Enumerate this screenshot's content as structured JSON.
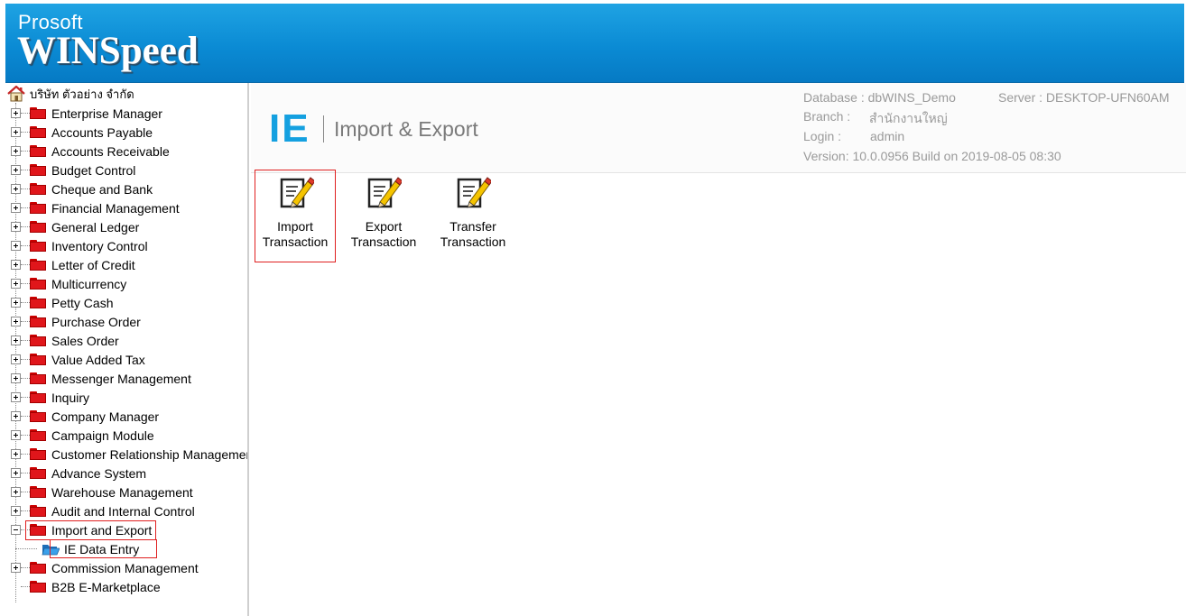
{
  "header": {
    "brand_top": "Prosoft",
    "brand_main": "WINSpeed"
  },
  "tree": {
    "root_label": "บริษัท ตัวอย่าง จำกัด",
    "items": [
      {
        "label": "Enterprise Manager",
        "expander": "plus"
      },
      {
        "label": "Accounts Payable",
        "expander": "plus"
      },
      {
        "label": "Accounts Receivable",
        "expander": "plus"
      },
      {
        "label": "Budget Control",
        "expander": "plus"
      },
      {
        "label": "Cheque and Bank",
        "expander": "plus"
      },
      {
        "label": "Financial Management",
        "expander": "plus"
      },
      {
        "label": "General Ledger",
        "expander": "plus"
      },
      {
        "label": "Inventory Control",
        "expander": "plus"
      },
      {
        "label": "Letter of Credit",
        "expander": "plus"
      },
      {
        "label": "Multicurrency",
        "expander": "plus"
      },
      {
        "label": "Petty Cash",
        "expander": "plus"
      },
      {
        "label": "Purchase Order",
        "expander": "plus"
      },
      {
        "label": "Sales Order",
        "expander": "plus"
      },
      {
        "label": "Value Added Tax",
        "expander": "plus"
      },
      {
        "label": "Messenger Management",
        "expander": "plus"
      },
      {
        "label": "Inquiry",
        "expander": "plus"
      },
      {
        "label": "Company Manager",
        "expander": "plus"
      },
      {
        "label": "Campaign Module",
        "expander": "plus"
      },
      {
        "label": "Customer Relationship Managemer",
        "expander": "plus"
      },
      {
        "label": "Advance System",
        "expander": "plus"
      },
      {
        "label": "Warehouse Management",
        "expander": "plus"
      },
      {
        "label": "Audit and Internal Control",
        "expander": "plus"
      },
      {
        "label": "Import and Export",
        "expander": "minus",
        "highlighted": true
      },
      {
        "label": "IE Data Entry",
        "child": true,
        "selected": true
      },
      {
        "label": "Commission Management",
        "expander": "plus"
      },
      {
        "label": "B2B E-Marketplace",
        "expander": "none"
      }
    ]
  },
  "main": {
    "ie_mark": "IE",
    "ie_title": "Import & Export",
    "info": {
      "database": "Database : dbWINS_Demo",
      "server": "Server : DESKTOP-UFN60AM",
      "branch_label": "Branch :",
      "branch_value": "สำนักงานใหญ่",
      "login_label": "Login :",
      "login_value": "admin",
      "version": "Version: 10.0.0956 Build on 2019-08-05 08:30"
    },
    "modules": [
      {
        "line1": "Import",
        "line2": "Transaction",
        "icon": "edit-document-icon",
        "highlighted": true
      },
      {
        "line1": "Export",
        "line2": "Transaction",
        "icon": "edit-document-icon"
      },
      {
        "line1": "Transfer",
        "line2": "Transaction",
        "icon": "edit-document-icon"
      }
    ]
  },
  "colors": {
    "banner": "#0b8bd4",
    "accent": "#14a0e0",
    "folder": "#e0161b",
    "highlight": "#e02020"
  }
}
